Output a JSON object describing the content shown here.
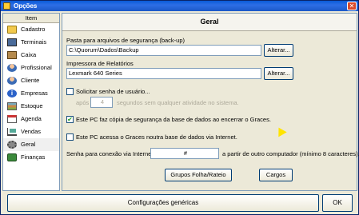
{
  "window": {
    "title": "Opções",
    "close_glyph": "✕"
  },
  "sidebar": {
    "header": "Item",
    "items": [
      {
        "label": "Cadastro",
        "icon": "folder-icon"
      },
      {
        "label": "Terminais",
        "icon": "monitor-icon"
      },
      {
        "label": "Caixa",
        "icon": "cash-box-icon"
      },
      {
        "label": "Profissional",
        "icon": "person-icon"
      },
      {
        "label": "Cliente",
        "icon": "client-icon"
      },
      {
        "label": "Empresas",
        "icon": "info-icon"
      },
      {
        "label": "Estoque",
        "icon": "stock-icon"
      },
      {
        "label": "Agenda",
        "icon": "calendar-icon"
      },
      {
        "label": "Vendas",
        "icon": "cart-icon"
      },
      {
        "label": "Geral",
        "icon": "gear-icon"
      },
      {
        "label": "Finanças",
        "icon": "money-icon"
      }
    ],
    "info_glyph": "i"
  },
  "panel": {
    "title": "Geral",
    "backup": {
      "label": "Pasta para arquivos de segurança (back-up)",
      "value": "C:\\Quorum\\Dados\\Backup",
      "button": "Alterar..."
    },
    "printer": {
      "label": "Impressora de Relatórios",
      "value": "Lexmark 640 Series",
      "button": "Alterar..."
    },
    "password": {
      "label": "Solicitar senha de usuário...",
      "checked": false,
      "after_label": "após",
      "minutes": "4",
      "suffix": "segundos sem qualquer atividade no sistema."
    },
    "backup_on_exit": {
      "label": "Este PC faz cópia de segurança da base de dados ao encerrar o Graces.",
      "checked": true,
      "check_glyph": "✔"
    },
    "internet_access": {
      "label": "Este PC acessa o Graces noutra base de dados via Internet.",
      "checked": false
    },
    "internet_password": {
      "label": "Senha  para conexão via Internet",
      "value": "#",
      "suffix": "a partir de outro computador (mínimo 8 caracteres)."
    },
    "groups_button": "Grupos Folha/Rateio",
    "roles_button": "Cargos"
  },
  "footer": {
    "general_settings_button": "Configurações genéricas",
    "ok_button": "OK"
  }
}
